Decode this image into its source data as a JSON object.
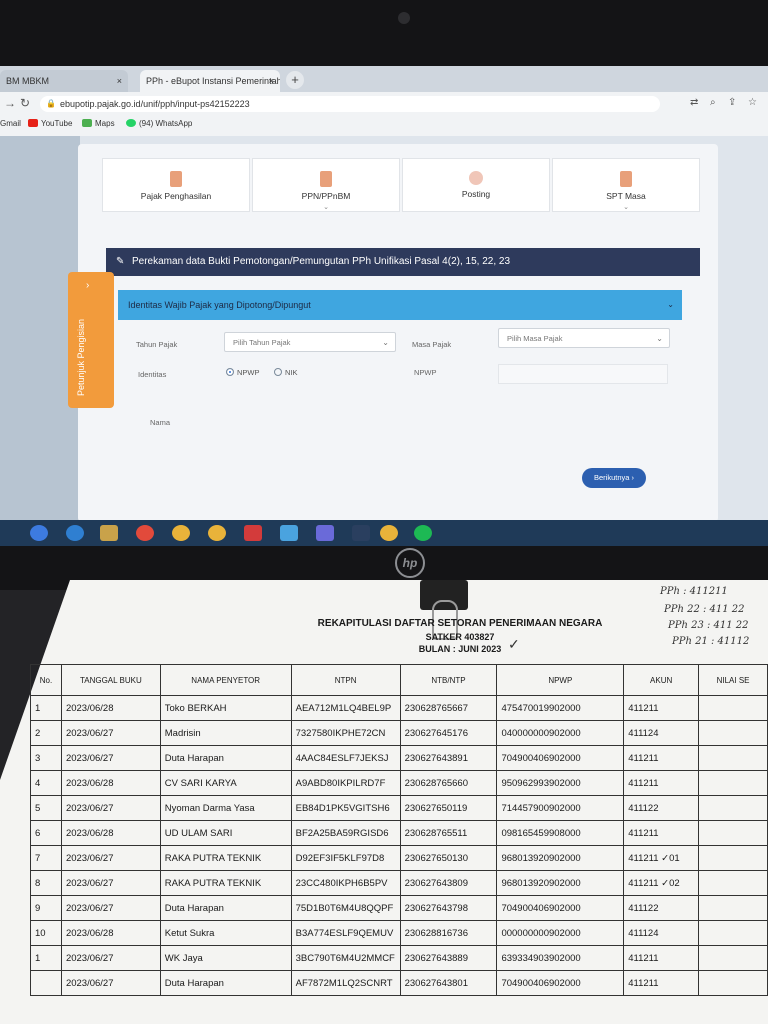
{
  "browser": {
    "tabs": [
      {
        "label": "BM MBKM",
        "close": "×"
      },
      {
        "label": "PPh - eBupot Instansi Pemerintah",
        "close": "×"
      }
    ],
    "new_tab": "+",
    "url": "ebupotip.pajak.go.id/unif/pph/input-ps42152223",
    "bookmarks": [
      "Gmail",
      "YouTube",
      "Maps",
      "(94) WhatsApp"
    ]
  },
  "app": {
    "menu": [
      {
        "label": "Pajak Penghasilan"
      },
      {
        "label": "PPN/PPnBM"
      },
      {
        "label": "Posting"
      },
      {
        "label": "SPT Masa"
      }
    ],
    "side_tab": "Petunjuk Pengisian",
    "header": "Perekaman data Bukti Pemotongan/Pemungutan PPh Unifikasi Pasal 4(2), 15, 22, 23",
    "section": "Identitas Wajib Pajak yang Dipotong/Dipungut",
    "form": {
      "tahun_label": "Tahun Pajak",
      "tahun_placeholder": "Pilih Tahun Pajak",
      "masa_label": "Masa Pajak",
      "masa_placeholder": "Pilih Masa Pajak",
      "identitas_label": "Identitas",
      "npwp_option": "NPWP",
      "nik_option": "NIK",
      "npwp_label": "NPWP",
      "nama_label": "Nama"
    },
    "next_button": "Berikutnya"
  },
  "document": {
    "title": "REKAPITULASI DAFTAR SETORAN PENERIMAAN NEGARA",
    "satker": "SATKER 403827",
    "bulan": "BULAN : JUNI 2023",
    "handwritten": [
      "PPh : 411211",
      "PPh 22 : 411 22",
      "PPh 23 : 411 22",
      "PPh 21 : 41112"
    ],
    "columns": [
      "No.",
      "TANGGAL BUKU",
      "NAMA PENYETOR",
      "NTPN",
      "NTB/NTP",
      "NPWP",
      "AKUN",
      "NILAI SE"
    ],
    "rows": [
      [
        "1",
        "2023/06/28",
        "Toko BERKAH",
        "AEA712M1LQ4BEL9P",
        "230628765667",
        "475470019902000",
        "411211"
      ],
      [
        "2",
        "2023/06/27",
        "Madrisin",
        "7327580IKPHE72CN",
        "230627645176",
        "040000000902000",
        "411124"
      ],
      [
        "3",
        "2023/06/27",
        "Duta Harapan",
        "4AAC84ESLF7JEKSJ",
        "230627643891",
        "704900406902000",
        "411211"
      ],
      [
        "4",
        "2023/06/28",
        "CV SARI KARYA",
        "A9ABD80IKPILRD7F",
        "230628765660",
        "950962993902000",
        "411211"
      ],
      [
        "5",
        "2023/06/27",
        "Nyoman Darma Yasa",
        "EB84D1PK5VGITSH6",
        "230627650119",
        "714457900902000",
        "411122"
      ],
      [
        "6",
        "2023/06/28",
        "UD ULAM SARI",
        "BF2A25BA59RGISD6",
        "230628765511",
        "098165459908000",
        "411211"
      ],
      [
        "7",
        "2023/06/27",
        "RAKA PUTRA TEKNIK",
        "D92EF3IF5KLF97D8",
        "230627650130",
        "968013920902000",
        "411211 ✓01"
      ],
      [
        "8",
        "2023/06/27",
        "RAKA PUTRA TEKNIK",
        "23CC480IKPH6B5PV",
        "230627643809",
        "968013920902000",
        "411211 ✓02"
      ],
      [
        "9",
        "2023/06/27",
        "Duta Harapan",
        "75D1B0T6M4U8QQPF",
        "230627643798",
        "704900406902000",
        "411122"
      ],
      [
        "10",
        "2023/06/28",
        "Ketut Sukra",
        "B3A774ESLF9QEMUV",
        "230628816736",
        "000000000902000",
        "411124"
      ],
      [
        "1",
        "2023/06/27",
        "WK Jaya",
        "3BC790T6M4U2MMCF",
        "230627643889",
        "639334903902000",
        "411211"
      ],
      [
        "",
        "2023/06/27",
        "Duta Harapan",
        "AF7872M1LQ2SCNRT",
        "230627643801",
        "704900406902000",
        "411211"
      ]
    ]
  },
  "brand": "hp"
}
